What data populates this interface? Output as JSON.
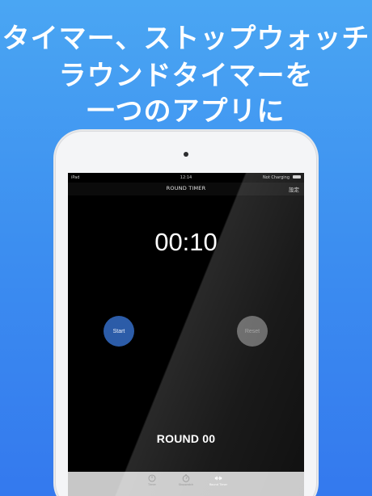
{
  "headline": {
    "line1": "タイマー、ストップウォッチ",
    "line2": "ラウンドタイマーを",
    "line3": "一つのアプリに"
  },
  "status_bar": {
    "carrier": "iPad",
    "time": "12:14",
    "battery_text": "Not Charging"
  },
  "nav": {
    "title": "ROUND TIMER",
    "settings_label": "設定"
  },
  "timer": {
    "display": "00:10"
  },
  "controls": {
    "start_label": "Start",
    "reset_label": "Reset"
  },
  "round": {
    "label": "ROUND 00"
  },
  "tabs": [
    {
      "label": "Timer",
      "icon": "timer-icon",
      "active": false
    },
    {
      "label": "Stopwatch",
      "icon": "stopwatch-icon",
      "active": false
    },
    {
      "label": "Round Timer",
      "icon": "round-timer-icon",
      "active": true
    }
  ],
  "colors": {
    "background_top": "#4aa6f3",
    "background_bottom": "#3479ee",
    "start_button": "#2c5ca8",
    "reset_button": "#5c5c5c",
    "tab_bar": "#c7c7c7"
  }
}
